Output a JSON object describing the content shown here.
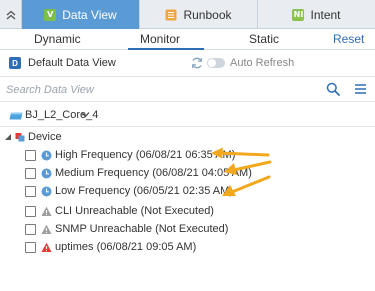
{
  "top_tabs": {
    "collapse_icon": "double-chevron-up-icon",
    "tabs": [
      {
        "label": "Data View",
        "icon": "V",
        "active": true
      },
      {
        "label": "Runbook",
        "icon": "runbook-icon",
        "active": false
      },
      {
        "label": "Intent",
        "icon": "NI",
        "active": false
      }
    ]
  },
  "sub_tabs": {
    "items": [
      "Dynamic",
      "Monitor",
      "Static"
    ],
    "active": "Monitor",
    "reset_label": "Reset"
  },
  "data_view": {
    "icon": "D",
    "label": "Default Data View",
    "auto_refresh_label": "Auto Refresh",
    "auto_refresh_on": false
  },
  "search": {
    "placeholder": "Search Data View",
    "value": ""
  },
  "device_selector": {
    "label": "BJ_L2_Core_4"
  },
  "tree": {
    "root_label": "Device",
    "items": [
      {
        "label": "High Frequency (06/08/21 06:35 AM)",
        "status": "clock",
        "highlighted": true
      },
      {
        "label": "Medium Frequency (06/08/21 04:05 AM)",
        "status": "clock",
        "highlighted": true
      },
      {
        "label": "Low Frequency (06/05/21 02:35 AM)",
        "status": "clock",
        "highlighted": true
      },
      {
        "label": "CLI Unreachable (Not Executed)",
        "status": "warning-gray",
        "highlighted": false
      },
      {
        "label": "SNMP Unreachable (Not Executed)",
        "status": "warning-gray",
        "highlighted": false
      },
      {
        "label": "uptimes (06/08/21 09:05 AM)",
        "status": "warning-red",
        "highlighted": false
      }
    ]
  },
  "colors": {
    "active_tab": "#5b9bd5",
    "accent": "#2f6db5",
    "arrow": "#f2a81d",
    "clock": "#5b9bd5",
    "warning_gray": "#9e9e9e",
    "warning_red": "#e53935"
  }
}
